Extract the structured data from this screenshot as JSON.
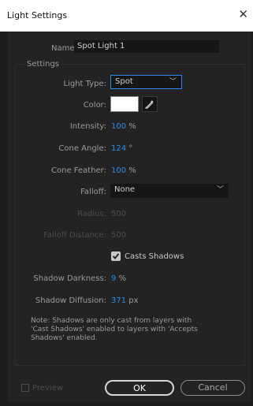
{
  "window": {
    "title": "Light Settings",
    "close_glyph": "✕"
  },
  "name": {
    "label": "Name:",
    "value": "Spot Light 1"
  },
  "settings": {
    "group_title": "Settings",
    "light_type": {
      "label": "Light Type:",
      "value": "Spot"
    },
    "color": {
      "label": "Color:",
      "swatch_hex": "#ffffff"
    },
    "intensity": {
      "label": "Intensity:",
      "value": "100",
      "unit": "%"
    },
    "cone_angle": {
      "label": "Cone Angle:",
      "value": "124",
      "unit": "°"
    },
    "cone_feather": {
      "label": "Cone Feather:",
      "value": "100",
      "unit": "%"
    },
    "falloff": {
      "label": "Falloff:",
      "value": "None"
    },
    "radius": {
      "label": "Radius:",
      "value": "500"
    },
    "falloff_distance": {
      "label": "Falloff Distance:",
      "value": "500"
    },
    "casts_shadows": {
      "label": "Casts Shadows",
      "checked": true
    },
    "shadow_darkness": {
      "label": "Shadow Darkness:",
      "value": "9",
      "unit": "%"
    },
    "shadow_diffusion": {
      "label": "Shadow Diffusion:",
      "value": "371",
      "unit": "px"
    },
    "note": "Note: Shadows are only cast from layers with 'Cast Shadows' enabled to layers with 'Accepts Shadows' enabled."
  },
  "footer": {
    "preview_label": "Preview",
    "ok_label": "OK",
    "cancel_label": "Cancel"
  },
  "colors": {
    "accent": "#2d8ceb",
    "background": "#232323"
  }
}
